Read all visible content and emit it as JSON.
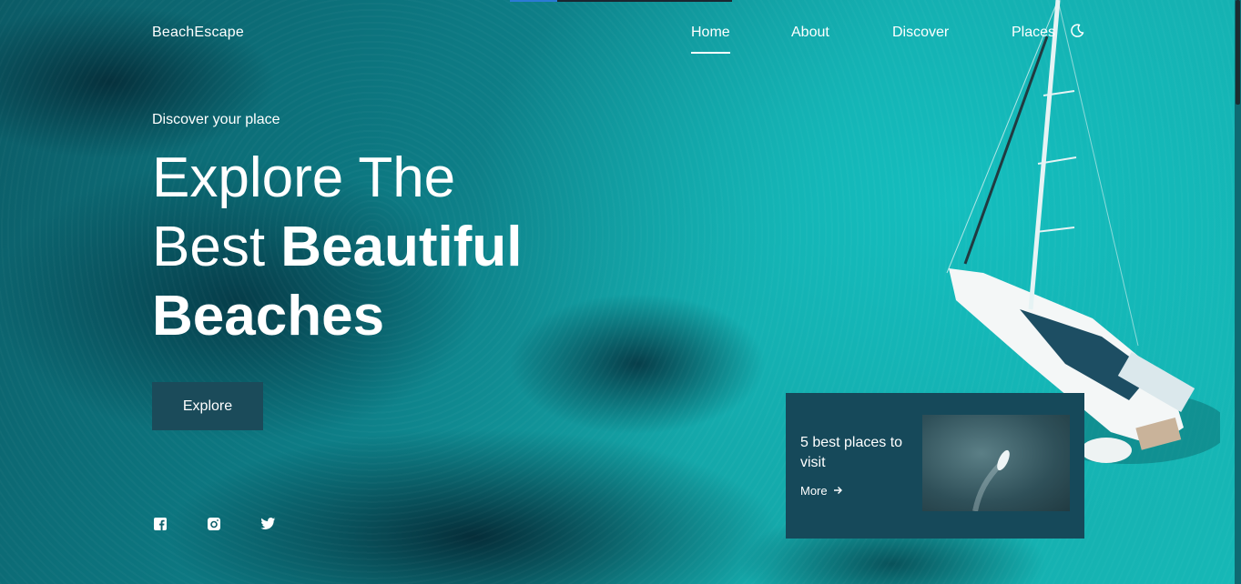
{
  "brand": {
    "logo": "BeachEscape"
  },
  "nav": {
    "items": [
      {
        "label": "Home",
        "active": true
      },
      {
        "label": "About",
        "active": false
      },
      {
        "label": "Discover",
        "active": false
      },
      {
        "label": "Places",
        "active": false
      }
    ],
    "theme_toggle_icon": "moon-icon"
  },
  "hero": {
    "subtitle": "Discover your place",
    "title_line1": "Explore The",
    "title_line2_regular": "Best ",
    "title_line2_bold": "Beautiful",
    "title_line3_bold": "Beaches",
    "button_label": "Explore"
  },
  "social": {
    "icons": [
      "facebook-icon",
      "instagram-icon",
      "twitter-icon"
    ]
  },
  "card": {
    "title": "5 best places to visit",
    "more_label": "More"
  },
  "colors": {
    "button_bg": "#1b4b5a",
    "card_bg": "#16495a",
    "water": "#14a6a8"
  }
}
